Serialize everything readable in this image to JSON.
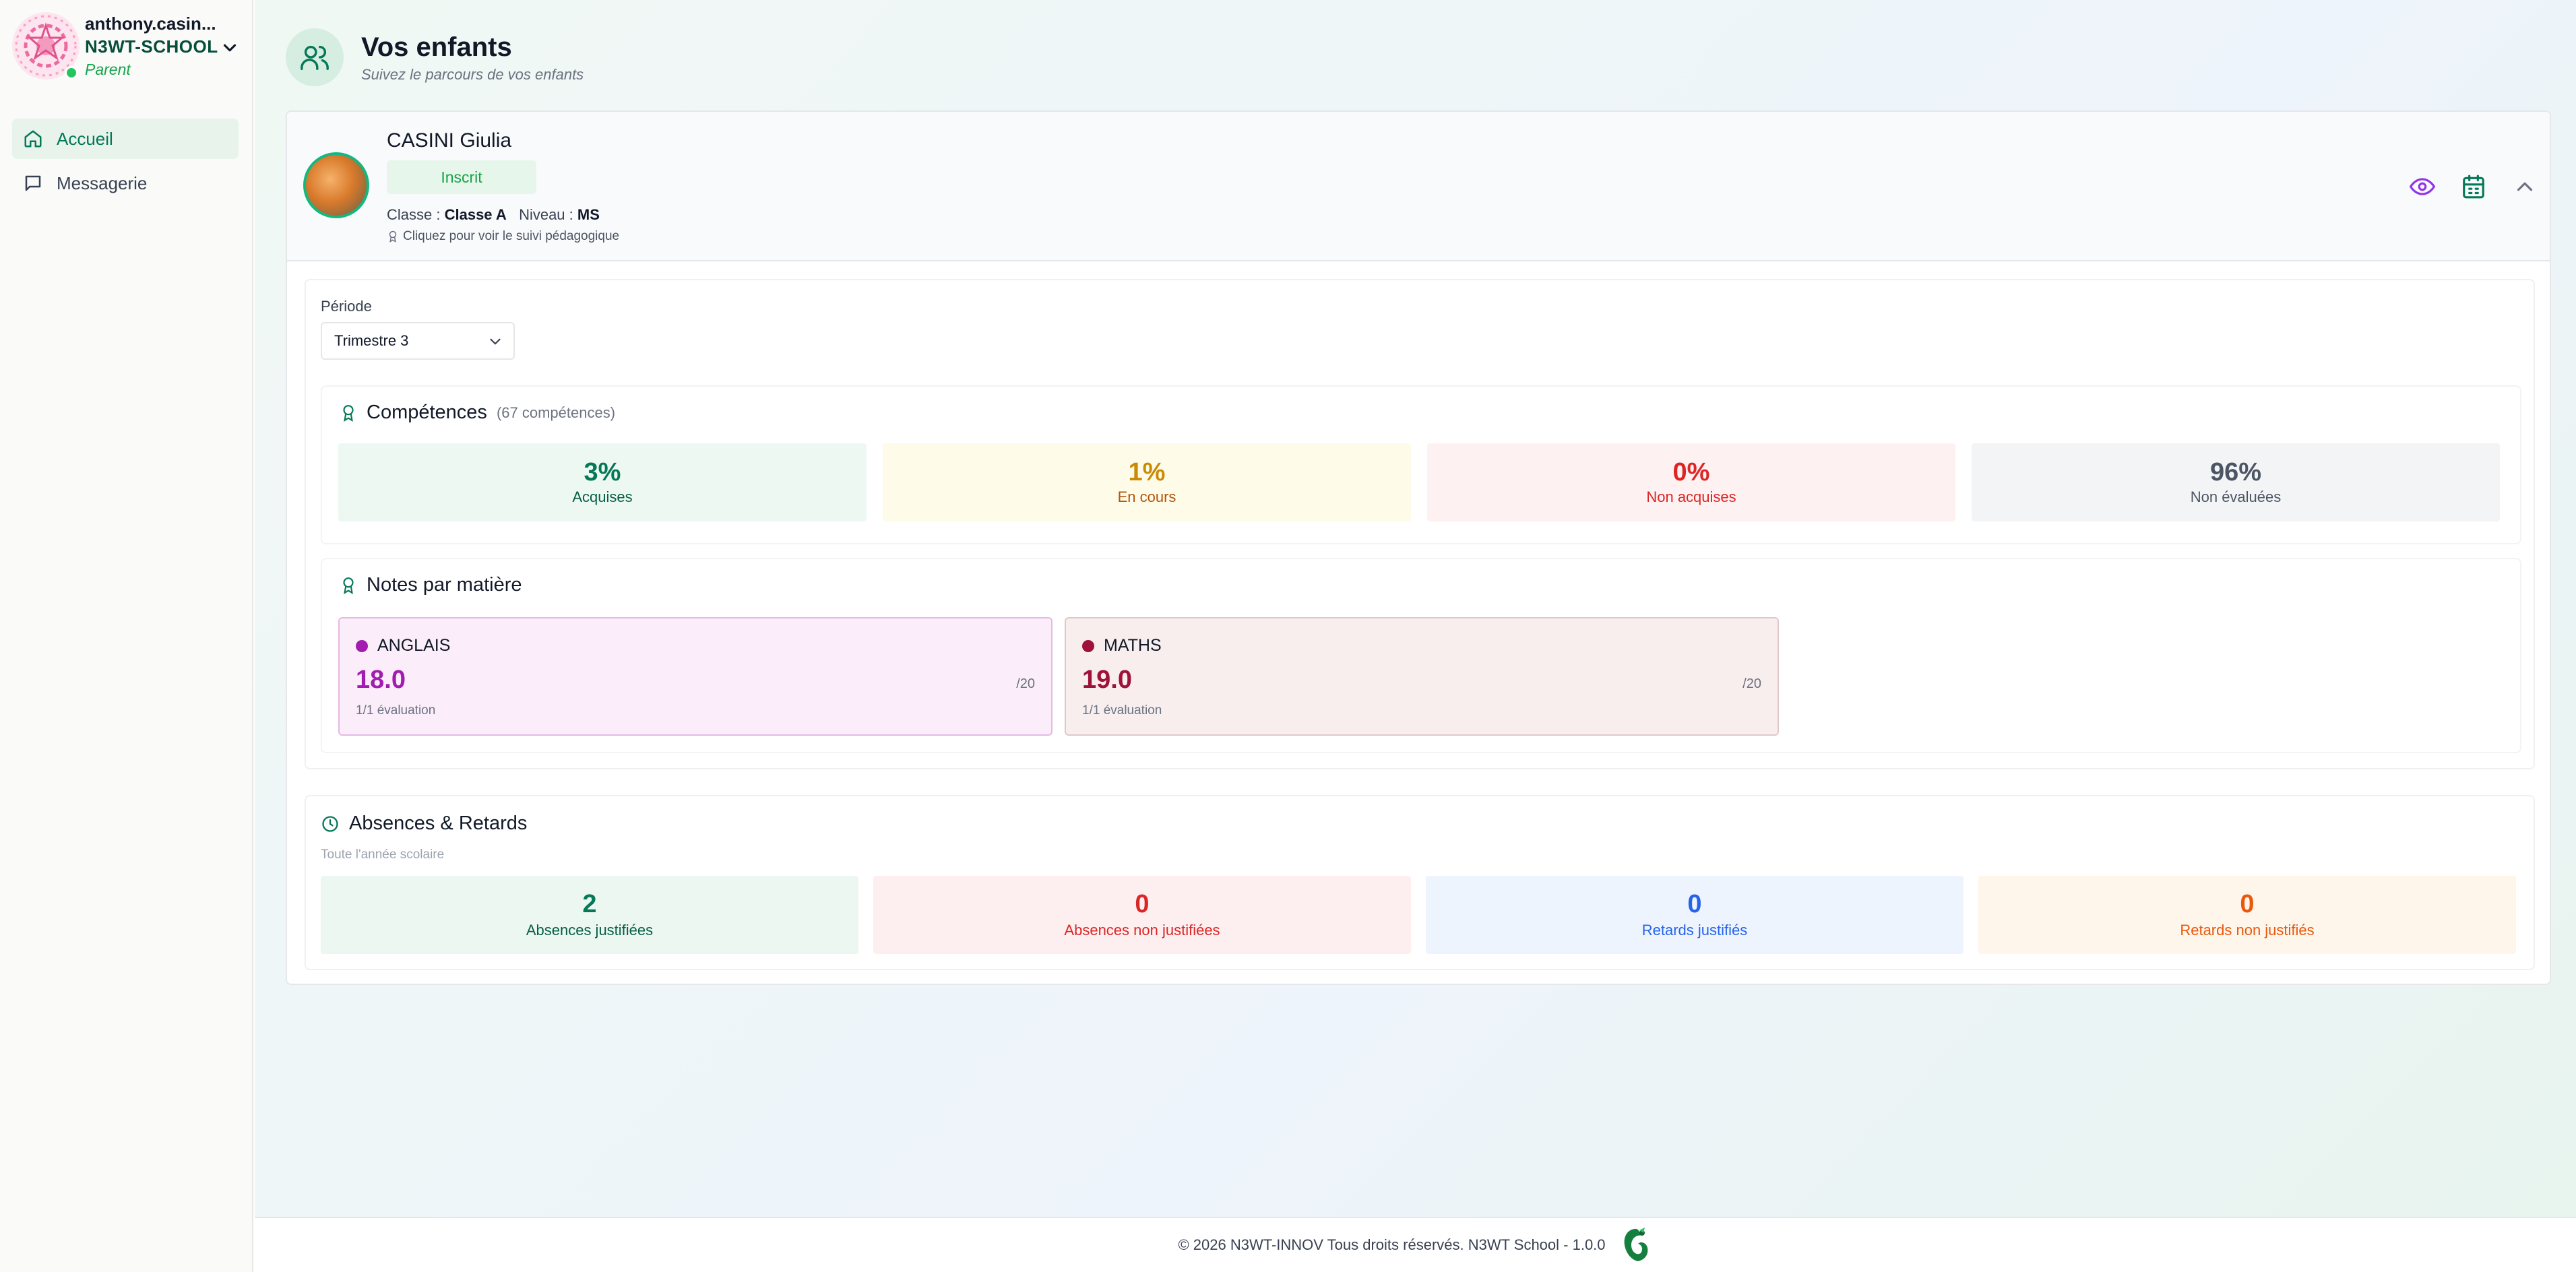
{
  "user": {
    "name": "anthony.casin...",
    "school": "N3WT-SCHOOL",
    "role": "Parent"
  },
  "sidebar": {
    "items": [
      {
        "label": "Accueil",
        "icon": "home-icon",
        "active": true
      },
      {
        "label": "Messagerie",
        "icon": "message-icon",
        "active": false
      }
    ]
  },
  "header": {
    "title": "Vos enfants",
    "subtitle": "Suivez le parcours de vos enfants"
  },
  "child": {
    "name": "CASINI Giulia",
    "status": "Inscrit",
    "class_label": "Classe : ",
    "class_value": "Classe A",
    "level_label": "Niveau : ",
    "level_value": "MS",
    "hint": "Cliquez pour voir le suivi pédagogique"
  },
  "period": {
    "label": "Période",
    "selected": "Trimestre 3"
  },
  "competences": {
    "title": "Compétences",
    "count": "(67 compétences)",
    "stats": [
      {
        "value": "3%",
        "label": "Acquises",
        "color": "#047857",
        "bg": "#eef8f2"
      },
      {
        "value": "1%",
        "label": "En cours",
        "color": "#ca8a04",
        "bg": "#fefbe8"
      },
      {
        "value": "0%",
        "label": "Non acquises",
        "color": "#dc2626",
        "bg": "#fef1f1"
      },
      {
        "value": "96%",
        "label": "Non évaluées",
        "color": "#4b5563",
        "bg": "#f3f4f6"
      }
    ]
  },
  "notes": {
    "title": "Notes par matière",
    "subjects": [
      {
        "name": "ANGLAIS",
        "value": "18.0",
        "out_of": "/20",
        "evaluations": "1/1 évaluation",
        "color": "#a21caf",
        "bg": "#fbeefa",
        "border": "#e6b8e4"
      },
      {
        "name": "MATHS",
        "value": "19.0",
        "out_of": "/20",
        "evaluations": "1/1 évaluation",
        "color": "#9f1239",
        "bg": "#f8eeee",
        "border": "#e2c7c7"
      }
    ]
  },
  "absences": {
    "title": "Absences & Retards",
    "subtitle": "Toute l'année scolaire",
    "stats": [
      {
        "value": "2",
        "label": "Absences justifiées",
        "color": "#047857",
        "bg": "#edf7f1"
      },
      {
        "value": "0",
        "label": "Absences non justifiées",
        "color": "#dc2626",
        "bg": "#fdefef"
      },
      {
        "value": "0",
        "label": "Retards justifiés",
        "color": "#2563eb",
        "bg": "#eef4fe"
      },
      {
        "value": "0",
        "label": "Retards non justifiés",
        "color": "#ea580c",
        "bg": "#fef5eb"
      }
    ]
  },
  "footer": {
    "text": "© 2026 N3WT-INNOV Tous droits réservés. N3WT School - 1.0.0"
  }
}
